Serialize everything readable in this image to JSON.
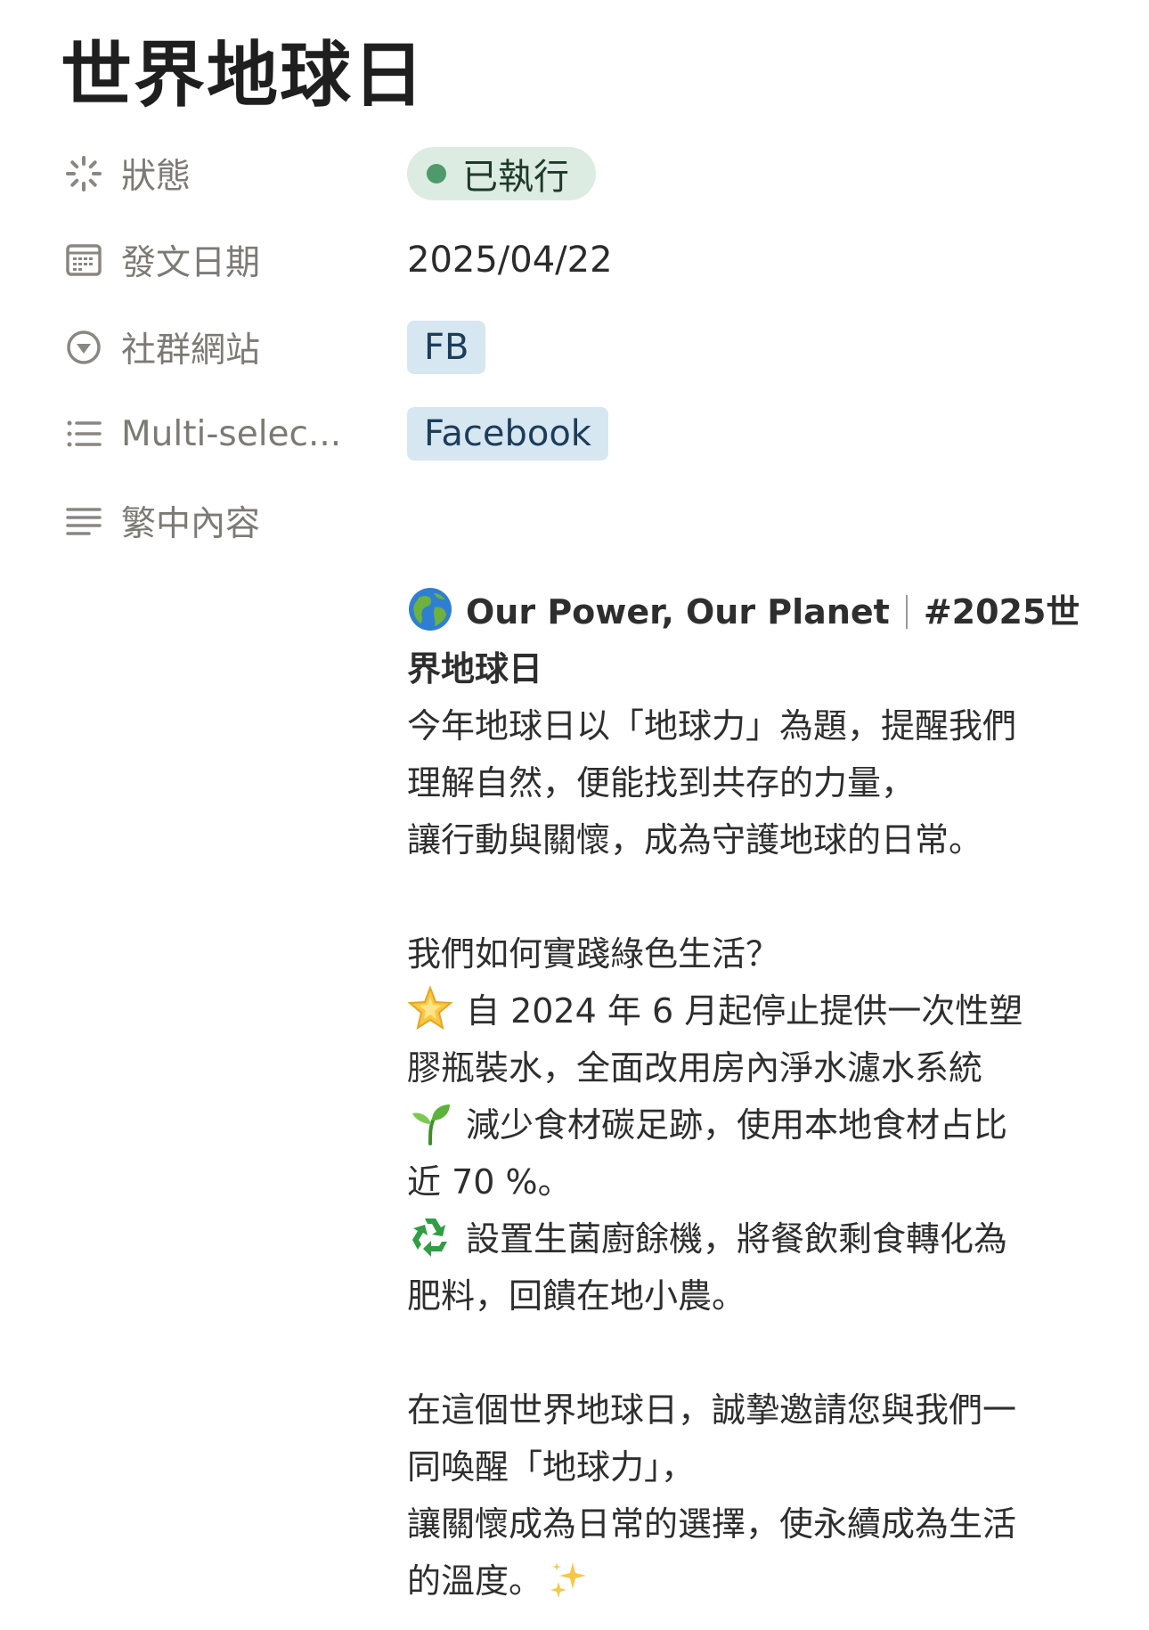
{
  "page": {
    "title": "世界地球日"
  },
  "properties": {
    "status": {
      "label": "狀態",
      "icon": "status-spinner-icon",
      "value": "已執行",
      "color": "#4e9a6b"
    },
    "post_date": {
      "label": "發文日期",
      "icon": "calendar-icon",
      "value": "2025/04/22"
    },
    "social": {
      "label": "社群網站",
      "icon": "select-circle-icon",
      "value": "FB"
    },
    "multi_select": {
      "label": "Multi-selec...",
      "icon": "list-icon",
      "value": "Facebook"
    },
    "content": {
      "label": "繁中內容",
      "icon": "text-lines-icon"
    }
  },
  "content": {
    "heading_part1": "Our Power, Our Planet",
    "heading_part2": "#2025世",
    "heading_line2": "界地球日",
    "p1_l1": "今年地球日以「地球力」為題，提醒我們",
    "p1_l2": "理解自然，便能找到共存的力量，",
    "p1_l3": "讓行動與關懷，成為守護地球的日常。",
    "p2_l1": "我們如何實踐綠色生活？",
    "item1_l1": "自 2024 年 6 月起停止提供一次性塑",
    "item1_l2": "膠瓶裝水，全面改用房內淨水濾水系統",
    "item2_l1": "減少食材碳足跡，使用本地食材占比",
    "item2_l2": "近 70 %。",
    "item3_l1": "設置生菌廚餘機，將餐飲剩食轉化為",
    "item3_l2": "肥料，回饋在地小農。",
    "p3_l1": "在這個世界地球日，誠摯邀請您與我們一",
    "p3_l2": "同喚醒「地球力」，",
    "p3_l3": "讓關懷成為日常的選擇，使永續成為生活",
    "p3_l4": "的溫度。",
    "emojis": [
      "globe-emoji",
      "star-emoji",
      "seedling-emoji",
      "recycle-emoji",
      "sparkles-emoji"
    ]
  }
}
